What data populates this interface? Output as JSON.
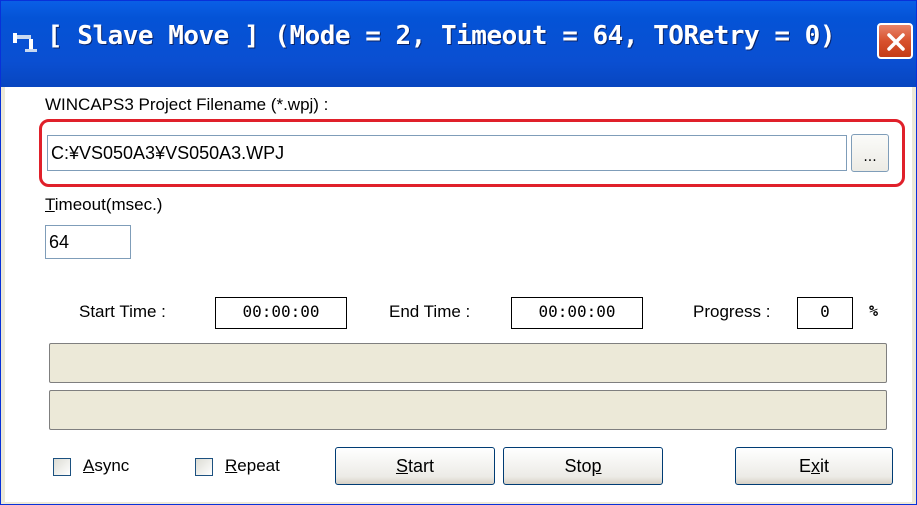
{
  "window": {
    "title": "[ Slave Move ] (Mode = 2, Timeout = 64, TORetry = 0)"
  },
  "project": {
    "label": "WINCAPS3 Project Filename (*.wpj) :",
    "value": "C:¥VS050A3¥VS050A3.WPJ",
    "browse_label": "..."
  },
  "timeout": {
    "label_key": "T",
    "label_rest": "imeout(msec.)",
    "value": "64"
  },
  "status": {
    "start_label": "Start Time :",
    "start_value": "00:00:00",
    "end_label": "End Time :",
    "end_value": "00:00:00",
    "progress_label": "Progress :",
    "progress_value": "0",
    "progress_unit": "%"
  },
  "options": {
    "async_key": "A",
    "async_rest": "sync",
    "async_checked": false,
    "repeat_key": "R",
    "repeat_rest": "epeat",
    "repeat_checked": false
  },
  "buttons": {
    "start_key": "S",
    "start_rest": "tart",
    "stop_pre": "Sto",
    "stop_key": "p",
    "exit_pre": "E",
    "exit_key": "x",
    "exit_rest": "it"
  },
  "colors": {
    "highlight": "#e0202a",
    "titlebar": "#0a4fd2"
  },
  "icons": {
    "app": "robot-arm-icon",
    "close": "close-icon"
  }
}
